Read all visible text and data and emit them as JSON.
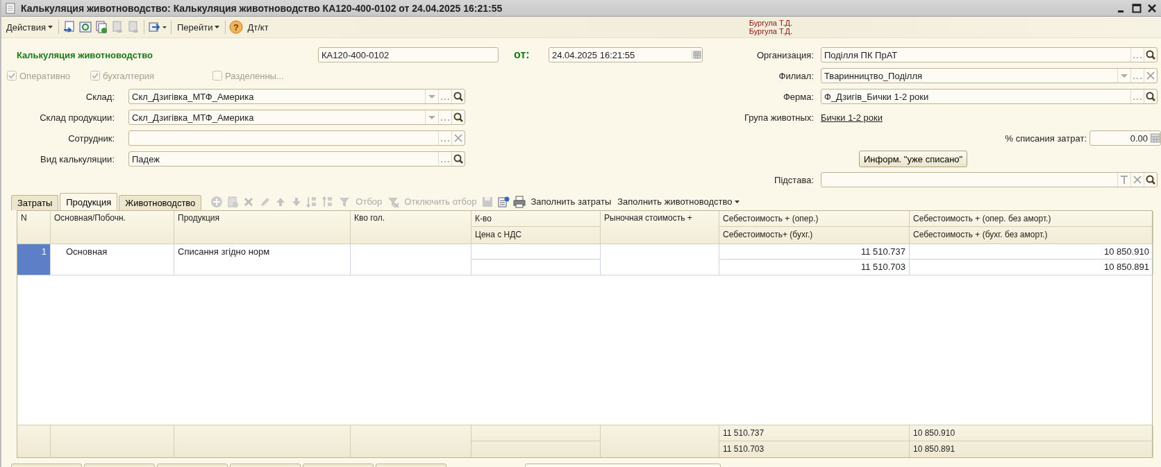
{
  "window": {
    "title": "Калькуляция животноводство: Калькуляция животноводство КА120-400-0102 от 24.04.2025 16:21:55"
  },
  "toolbar": {
    "actions": "Действия",
    "goto": "Перейти",
    "help": "?",
    "dtkt": "Дт/кт"
  },
  "authors": [
    "Бургула Т.Д.",
    "Бургула Т.Д."
  ],
  "header": {
    "doc_type": "Калькуляция животноводство",
    "number": "КА120-400-0102",
    "date_label": "от:",
    "date": "24.04.2025 16:21:55"
  },
  "checkboxes": [
    {
      "label": "Оперативно",
      "checked": true,
      "disabled": true
    },
    {
      "label": "бухгалтерия",
      "checked": true,
      "disabled": true
    },
    {
      "label": "Разделенны...",
      "checked": false,
      "disabled": true
    }
  ],
  "left_fields": [
    {
      "label": "Склад:",
      "value": "Скл_Дзигівка_МТФ_Америка",
      "buttons": [
        {
          "kind": "dropdown"
        },
        {
          "kind": "select"
        },
        {
          "kind": "search"
        }
      ]
    },
    {
      "label": "Склад продукции:",
      "value": "Скл_Дзигівка_МТФ_Америка",
      "buttons": [
        {
          "kind": "dropdown"
        },
        {
          "kind": "select"
        },
        {
          "kind": "search"
        }
      ]
    },
    {
      "label": "Сотрудник:",
      "buttons": [
        {
          "kind": "select"
        },
        {
          "kind": "clear"
        }
      ]
    },
    {
      "label": "Вид калькуляции:",
      "value": "Падеж",
      "buttons": [
        {
          "kind": "select"
        },
        {
          "kind": "search"
        }
      ]
    }
  ],
  "right_fields": [
    {
      "label": "Организация:",
      "value": "Поділля ПК ПрАТ",
      "buttons": [
        {
          "kind": "select"
        },
        {
          "kind": "search"
        }
      ]
    },
    {
      "label": "Филиал:",
      "value": "Тваринництво_Поділля",
      "buttons": [
        {
          "kind": "dropdown"
        },
        {
          "kind": "select"
        },
        {
          "kind": "clear"
        }
      ]
    },
    {
      "label": "Ферма:",
      "value": "Ф_Дзигів_Бички 1-2 роки",
      "buttons": [
        {
          "kind": "select"
        },
        {
          "kind": "search"
        }
      ]
    }
  ],
  "animal_group": {
    "label": "Група животных:",
    "value": "Бички 1-2 роки"
  },
  "write_off": {
    "label": "% списания затрат:",
    "value": "0.00"
  },
  "info_button": "Информ. \"уже списано\"",
  "basis": {
    "label": "Підстава:",
    "buttons": [
      {
        "kind": "text"
      },
      {
        "kind": "clear"
      },
      {
        "kind": "search"
      }
    ]
  },
  "tabs": [
    {
      "label": "Затраты",
      "selected": false
    },
    {
      "label": "Продукция",
      "selected": true
    },
    {
      "label": "Животноводство",
      "selected": false
    }
  ],
  "table_toolbar": [
    {
      "label": "Отбор",
      "disabled": true
    },
    {
      "label": "Отключить отбор",
      "disabled": true
    },
    {
      "label": "Заполнить затраты",
      "disabled": false
    },
    {
      "label": "Заполнить животноводство",
      "disabled": false,
      "menu": true
    }
  ],
  "table": {
    "columns": [
      {
        "top": "N"
      },
      {
        "top": "Основная/Побочн."
      },
      {
        "top": "Продукция"
      },
      {
        "top": "Кво гол."
      },
      {
        "top": "К-во",
        "bottom": "Цена с НДС"
      },
      {
        "top": "Рыночная стоимость +"
      },
      {
        "top": "Себестоимость + (опер.)",
        "bottom": "Себестоимость+  (бухг.)"
      },
      {
        "top": "Себестоимость + (опер. без аморт.)",
        "bottom": "Себестоимость + (бухг. без аморт.)"
      }
    ],
    "rows": [
      {
        "selected": true,
        "n": "1",
        "type": "Основная",
        "product": "Списання згідно норм",
        "cost_oper": "11 510.737",
        "cost_acc": "11 510.703",
        "cost_oper_no_amort": "10 850.910",
        "cost_acc_no_amort": "10 850.891"
      }
    ],
    "totals": {
      "cost_oper": "11 510.737",
      "cost_acc": "11 510.703",
      "cost_oper_no_amort": "10 850.910",
      "cost_acc_no_amort": "10 850.891"
    }
  }
}
